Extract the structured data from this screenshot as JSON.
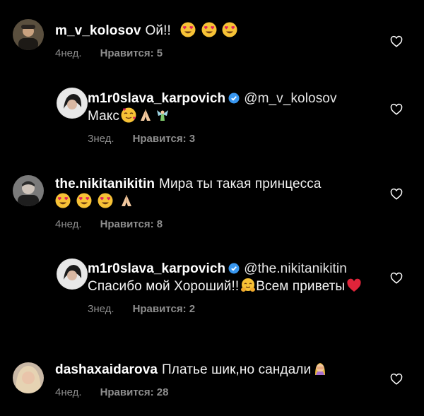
{
  "comments": [
    {
      "username": "m_v_kolosov",
      "text": "Ой!!",
      "emojis": [
        "heart-eyes",
        "heart-eyes",
        "heart-eyes"
      ],
      "age": "4нед.",
      "likes": "Нравится: 5",
      "verified": false
    },
    {
      "username": "m1r0slava_karpovich",
      "mention": "@m_v_kolosov",
      "text": "Макс",
      "emojis": [
        "smiling-face-with-hearts",
        "folded-hands",
        "fairy"
      ],
      "age": "3нед.",
      "likes": "Нравится: 3",
      "verified": true
    },
    {
      "username": "the.nikitanikitin",
      "text": "Мира ты такая принцесса",
      "emojis": [
        "heart-eyes",
        "heart-eyes",
        "heart-eyes",
        "folded-hands"
      ],
      "age": "4нед.",
      "likes": "Нравится: 8",
      "verified": false
    },
    {
      "username": "m1r0slava_karpovich",
      "mention": "@the.nikitanikitin",
      "text": "Спасибо мой Хороший!!",
      "text2": "Всем приветы",
      "emojis": [
        "hugging-face",
        "red-heart"
      ],
      "age": "3нед.",
      "likes": "Нравится: 2",
      "verified": true
    },
    {
      "username": "dashaxaidarova",
      "text": "Платье шик,но сандали",
      "emojis": [
        "person-facepalming"
      ],
      "age": "4нед.",
      "likes": "Нравится: 28",
      "verified": false
    }
  ],
  "colors": {
    "background": "#000000",
    "secondary_text": "#8e8e8e",
    "verified_blue": "#3897f0",
    "heart_outline": "#ffffff"
  }
}
